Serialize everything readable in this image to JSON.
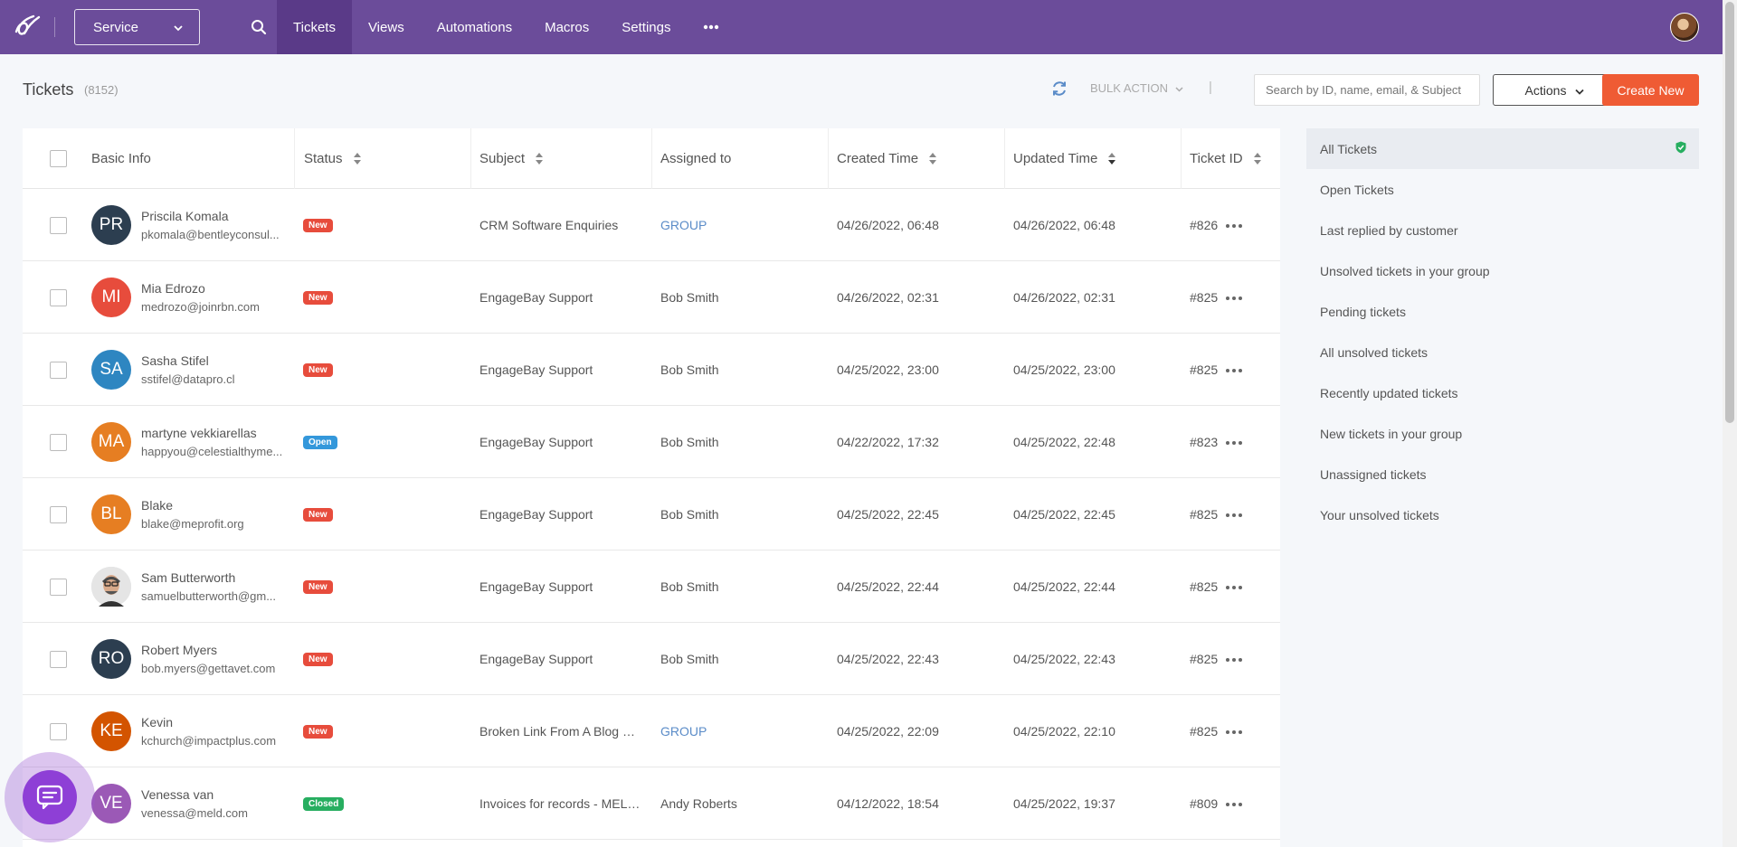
{
  "nav": {
    "service_select": "Service",
    "tabs": [
      {
        "label": "Tickets"
      },
      {
        "label": "Views"
      },
      {
        "label": "Automations"
      },
      {
        "label": "Macros"
      },
      {
        "label": "Settings"
      }
    ],
    "active_tab": "Tickets"
  },
  "header": {
    "title": "Tickets",
    "count": "(8152)",
    "bulk_action": "BULK ACTION",
    "separator": "|",
    "search_placeholder": "Search by ID, name, email, & Subject",
    "actions_label": "Actions",
    "create_label": "Create New"
  },
  "table": {
    "columns": [
      "Basic Info",
      "Status",
      "Subject",
      "Assigned to",
      "Created Time",
      "Updated Time",
      "Ticket ID"
    ],
    "rows": [
      {
        "initials": "PR",
        "avatar_color": "#2c3e50",
        "name": "Priscila Komala",
        "email": "pkomala@bentleyconsul...",
        "status": "New",
        "status_color": "#e74c3c",
        "subject": "CRM Software Enquiries",
        "assigned": "GROUP",
        "assigned_link": true,
        "created": "04/26/2022, 06:48",
        "updated": "04/26/2022, 06:48",
        "ticket_id": "#826"
      },
      {
        "initials": "MI",
        "avatar_color": "#e74c3c",
        "name": "Mia Edrozo",
        "email": "medrozo@joinrbn.com",
        "status": "New",
        "status_color": "#e74c3c",
        "subject": "EngageBay Support",
        "assigned": "Bob Smith",
        "assigned_link": false,
        "created": "04/26/2022, 02:31",
        "updated": "04/26/2022, 02:31",
        "ticket_id": "#825"
      },
      {
        "initials": "SA",
        "avatar_color": "#2e86c1",
        "name": "Sasha Stifel",
        "email": "sstifel@datapro.cl",
        "status": "New",
        "status_color": "#e74c3c",
        "subject": "EngageBay Support",
        "assigned": "Bob Smith",
        "assigned_link": false,
        "created": "04/25/2022, 23:00",
        "updated": "04/25/2022, 23:00",
        "ticket_id": "#825"
      },
      {
        "initials": "MA",
        "avatar_color": "#e67e22",
        "name": "martyne vekkiarellas",
        "email": "happyou@celestialthyme...",
        "status": "Open",
        "status_color": "#3498db",
        "subject": "EngageBay Support",
        "assigned": "Bob Smith",
        "assigned_link": false,
        "created": "04/22/2022, 17:32",
        "updated": "04/25/2022, 22:48",
        "ticket_id": "#823"
      },
      {
        "initials": "BL",
        "avatar_color": "#e67e22",
        "name": "Blake",
        "email": "blake@meprofit.org",
        "status": "New",
        "status_color": "#e74c3c",
        "subject": "EngageBay Support",
        "assigned": "Bob Smith",
        "assigned_link": false,
        "created": "04/25/2022, 22:45",
        "updated": "04/25/2022, 22:45",
        "ticket_id": "#825"
      },
      {
        "initials": "",
        "avatar_color": "#d5d8dc",
        "photo": true,
        "name": "Sam Butterworth",
        "email": "samuelbutterworth@gm...",
        "status": "New",
        "status_color": "#e74c3c",
        "subject": "EngageBay Support",
        "assigned": "Bob Smith",
        "assigned_link": false,
        "created": "04/25/2022, 22:44",
        "updated": "04/25/2022, 22:44",
        "ticket_id": "#825"
      },
      {
        "initials": "RO",
        "avatar_color": "#2c3e50",
        "name": "Robert Myers",
        "email": "bob.myers@gettavet.com",
        "status": "New",
        "status_color": "#e74c3c",
        "subject": "EngageBay Support",
        "assigned": "Bob Smith",
        "assigned_link": false,
        "created": "04/25/2022, 22:43",
        "updated": "04/25/2022, 22:43",
        "ticket_id": "#825"
      },
      {
        "initials": "KE",
        "avatar_color": "#d35400",
        "name": "Kevin",
        "email": "kchurch@impactplus.com",
        "status": "New",
        "status_color": "#e74c3c",
        "subject": "Broken Link From A Blog Po...",
        "assigned": "GROUP",
        "assigned_link": true,
        "created": "04/25/2022, 22:09",
        "updated": "04/25/2022, 22:10",
        "ticket_id": "#825"
      },
      {
        "initials": "VE",
        "avatar_color": "#9b59b6",
        "name": "Venessa van",
        "email": "venessa@meld.com",
        "status": "Closed",
        "status_color": "#27ae60",
        "subject": "Invoices for records - MELD ...",
        "assigned": "Andy Roberts",
        "assigned_link": false,
        "created": "04/12/2022, 18:54",
        "updated": "04/25/2022, 19:37",
        "ticket_id": "#809"
      }
    ]
  },
  "filters": [
    {
      "label": "All Tickets",
      "active": true
    },
    {
      "label": "Open Tickets"
    },
    {
      "label": "Last replied by customer"
    },
    {
      "label": "Unsolved tickets in your group"
    },
    {
      "label": "Pending tickets"
    },
    {
      "label": "All unsolved tickets"
    },
    {
      "label": "Recently updated tickets"
    },
    {
      "label": "New tickets in your group"
    },
    {
      "label": "Unassigned tickets"
    },
    {
      "label": "Your unsolved tickets"
    }
  ],
  "colors": {
    "brand": "#6b4c9a",
    "create": "#ef5b34",
    "link": "#5b8cc8"
  },
  "icons": [
    "logo-icon",
    "chevron-down-icon",
    "search-icon",
    "more-icon",
    "refresh-icon",
    "sort-icon",
    "shield-check-icon",
    "ellipsis-icon",
    "chat-icon"
  ]
}
